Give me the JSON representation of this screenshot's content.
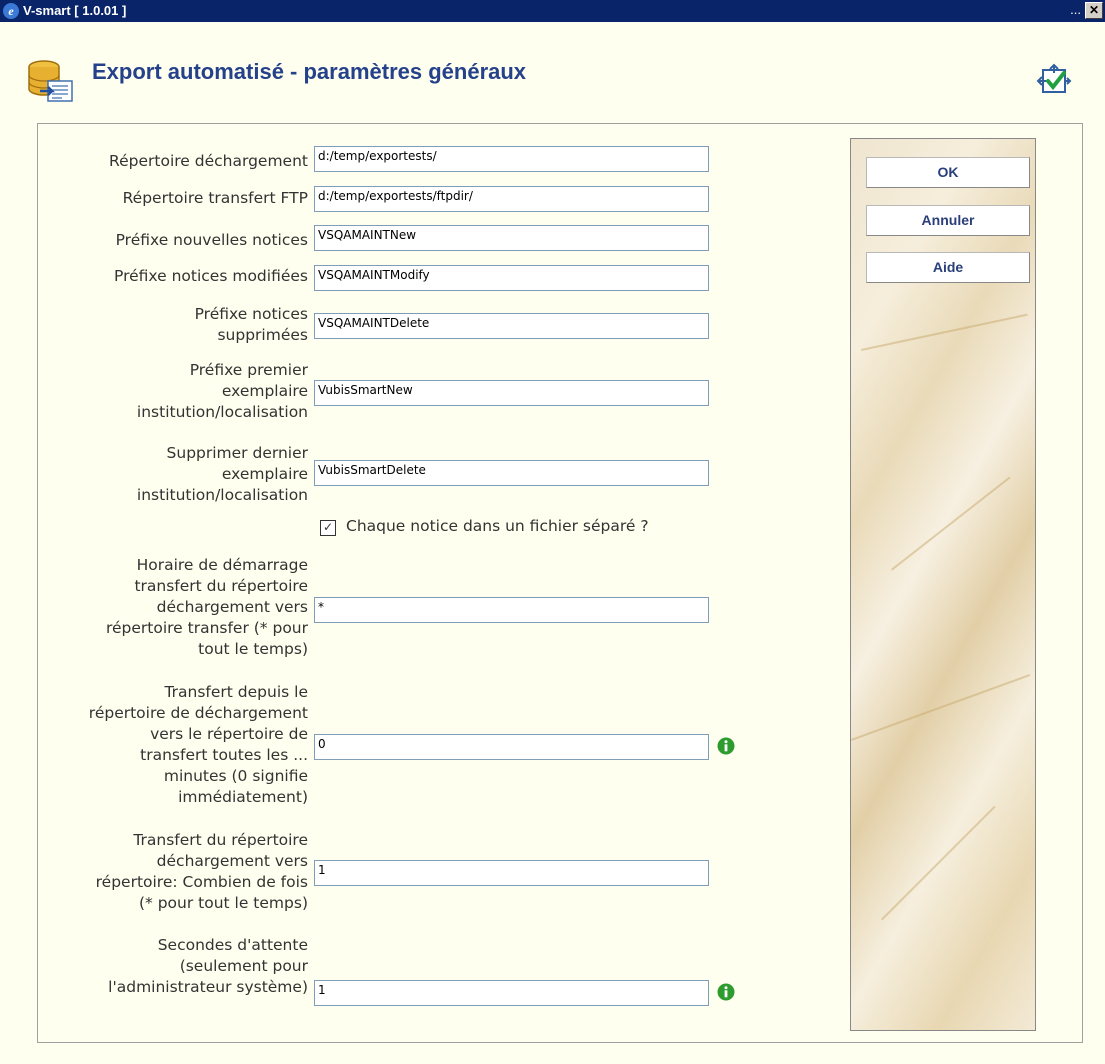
{
  "window": {
    "title": "V-smart [ 1.0.01 ]",
    "ellipsis": "...",
    "close_glyph": "✕",
    "app_glyph": "e"
  },
  "page": {
    "title": "Export automatisé - paramètres généraux"
  },
  "form": {
    "fields": [
      {
        "label": "Répertoire déchargement",
        "value": "d:/temp/exportests/"
      },
      {
        "label": "Répertoire transfert FTP",
        "value": "d:/temp/exportests/ftpdir/"
      },
      {
        "label": "Préfixe nouvelles notices",
        "value": "VSQAMAINTNew"
      },
      {
        "label": "Préfixe notices modifiées",
        "value": "VSQAMAINTModify"
      },
      {
        "label": "Préfixe notices supprimées",
        "value": "VSQAMAINTDelete"
      },
      {
        "label": "Préfixe premier exemplaire institution/localisation",
        "value": "VubisSmartNew"
      },
      {
        "label": "Supprimer dernier exemplaire institution/localisation",
        "value": "VubisSmartDelete"
      },
      {
        "label": "Horaire de démarrage transfert du répertoire déchargement vers répertoire transfer (* pour tout le temps)",
        "value": "*"
      },
      {
        "label": "Transfert depuis le répertoire de déchargement vers le répertoire de transfert toutes les ... minutes (0 signifie immédiatement)",
        "value": "0"
      },
      {
        "label": "Transfert du répertoire déchargement vers répertoire: Combien de fois (* pour tout le temps)",
        "value": "1"
      },
      {
        "label": "Secondes d'attente (seulement pour l'administrateur système)",
        "value": "1"
      }
    ],
    "separate_file": {
      "label": "Chaque notice dans un fichier séparé ?",
      "checked": true,
      "glyph": "✓"
    }
  },
  "buttons": {
    "ok": "OK",
    "cancel": "Annuler",
    "help": "Aide"
  },
  "icons": {
    "info": "info-icon",
    "check": "checkmark-icon",
    "database": "database-export-icon"
  },
  "colors": {
    "title": "#24418a",
    "titlebar": "#0a246a",
    "background": "#fffff0",
    "info": "#2e9b2e"
  }
}
